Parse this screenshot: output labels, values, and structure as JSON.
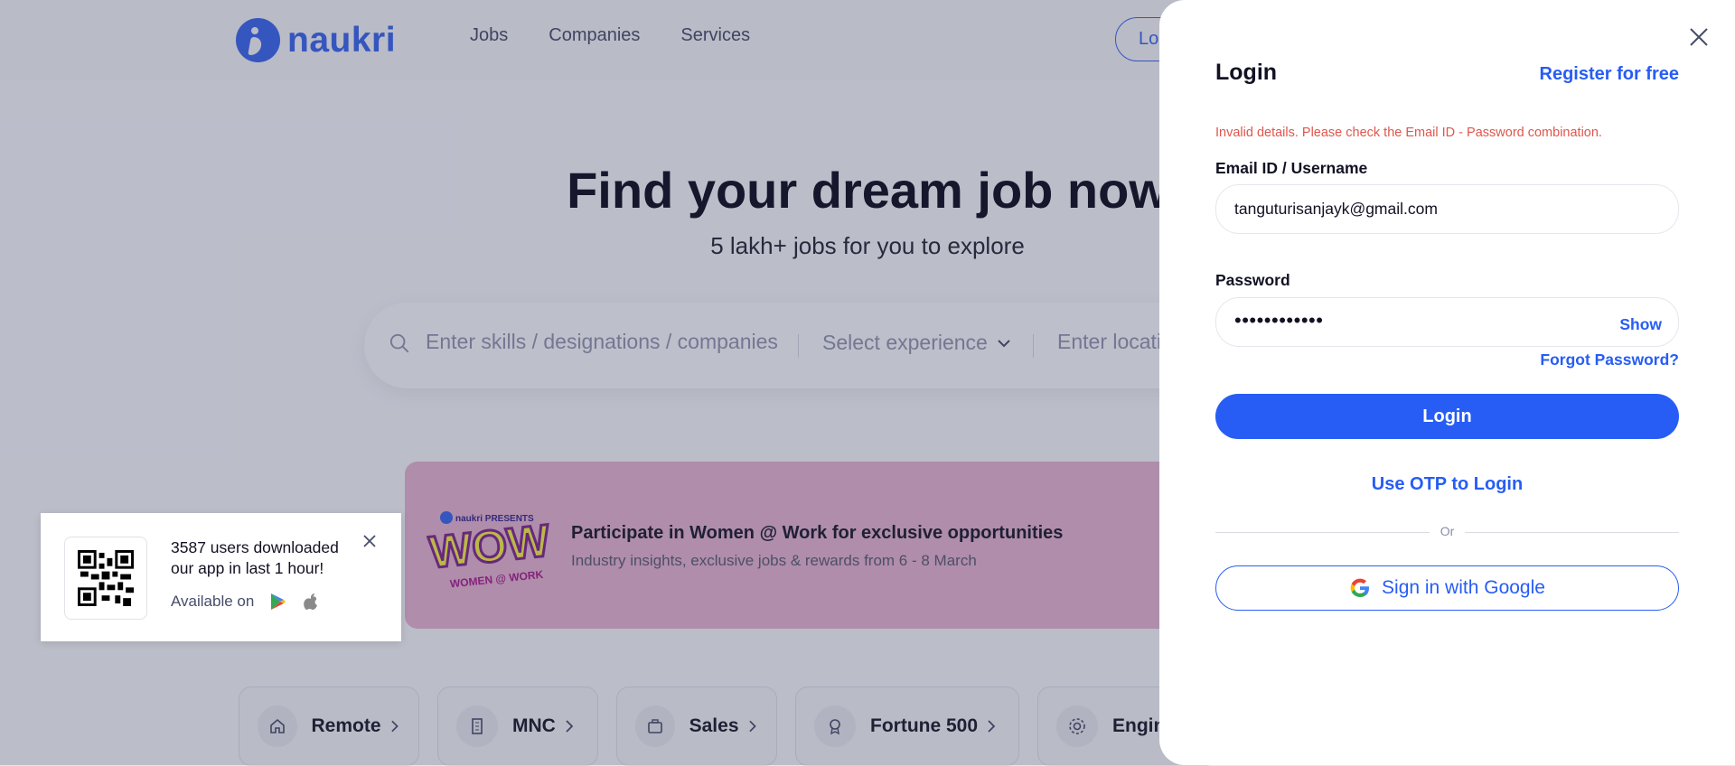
{
  "header": {
    "logo_text": "naukri",
    "nav": [
      "Jobs",
      "Companies",
      "Services"
    ],
    "login_partial": "Lo"
  },
  "hero": {
    "title": "Find your dream job now",
    "subtitle": "5 lakh+ jobs for you to explore"
  },
  "search": {
    "skills_placeholder": "Enter skills / designations / companies",
    "experience_placeholder": "Select experience",
    "location_placeholder_partial": "Enter locati"
  },
  "banner": {
    "logo_small": "naukri PRESENTS",
    "logo_main": "WOW",
    "logo_sub": "WOMEN @ WORK",
    "title": "Participate in Women @ Work for exclusive opportunities",
    "subtitle": "Industry insights, exclusive jobs & rewards from 6 - 8 March"
  },
  "app_popup": {
    "line1": "3587 users downloaded",
    "line2": "our app in last 1 hour!",
    "available": "Available on"
  },
  "chips": [
    {
      "label": "Remote",
      "icon": "home-icon"
    },
    {
      "label": "MNC",
      "icon": "building-icon"
    },
    {
      "label": "Sales",
      "icon": "briefcase-icon"
    },
    {
      "label": "Fortune 500",
      "icon": "award-icon"
    },
    {
      "label": "Engin",
      "icon": "gear-icon"
    }
  ],
  "login": {
    "title": "Login",
    "register": "Register for free",
    "error": "Invalid details. Please check the Email ID - Password combination.",
    "email_label": "Email ID / Username",
    "email_value": "tanguturisanjayk@gmail.com",
    "password_label": "Password",
    "password_dots": "••••••••••••",
    "show": "Show",
    "forgot": "Forgot Password?",
    "login_button": "Login",
    "otp": "Use OTP to Login",
    "or": "Or",
    "google": "Sign in with Google"
  },
  "colors": {
    "brand": "#275df5",
    "logo_blue": "#3a63e0",
    "error": "#e0564c",
    "banner_bg": "#d7a9c7"
  }
}
